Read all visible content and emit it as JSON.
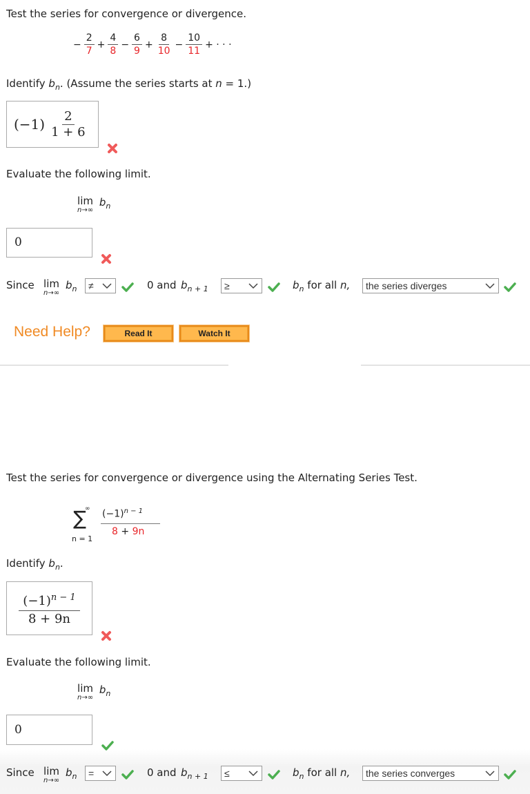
{
  "colors": {
    "accent_red": "#e8262a",
    "help_orange": "#f08a24",
    "button_fill": "#ffb84d",
    "check_green": "#4caf50",
    "x_red": "#f05a5a"
  },
  "problem1": {
    "prompt": "Test the series for convergence or divergence.",
    "series": {
      "terms": [
        {
          "sign": "−",
          "num": "2",
          "den": "7"
        },
        {
          "sign": "+",
          "num": "4",
          "den": "8"
        },
        {
          "sign": "−",
          "num": "6",
          "den": "9"
        },
        {
          "sign": "+",
          "num": "8",
          "den": "10"
        },
        {
          "sign": "−",
          "num": "10",
          "den": "11"
        }
      ],
      "tail": "+ · · ·"
    },
    "identify_label_pre": "Identify ",
    "identify_b": "b",
    "identify_sub": "n",
    "identify_label_post": ". (Assume the series starts at ",
    "identify_n": "n",
    "identify_eq": " = 1.)",
    "bn_answer": {
      "prefix": "(−1)",
      "num": "2",
      "den": "1 + 6"
    },
    "bn_status": "incorrect",
    "evaluate_label": "Evaluate the following limit.",
    "limit": {
      "lim": "lim",
      "sub": "n→∞",
      "b": "b",
      "bsub": "n"
    },
    "limit_answer": "0",
    "limit_status": "incorrect",
    "since": {
      "since_label": "Since",
      "lim": "lim",
      "lim_sub": "n→∞",
      "b": "b",
      "bsub": "n",
      "select1_value": "≠",
      "select1_status": "correct",
      "zero_and": "0 and",
      "b2": "b",
      "b2sub": "n + 1",
      "select2_value": "≥",
      "select2_status": "correct",
      "b3": "b",
      "b3sub": "n",
      "for_all": "for all",
      "n": "n,",
      "select3_value": "the series diverges",
      "select3_status": "correct"
    },
    "help": {
      "label": "Need Help?",
      "read_it": "Read It",
      "watch_it": "Watch It"
    }
  },
  "problem2": {
    "prompt": "Test the series for convergence or divergence using the Alternating Series Test.",
    "series": {
      "sum_upper": "∞",
      "sum_symbol": "∑",
      "sum_lower": "n = 1",
      "numerator_base": "(−1)",
      "numerator_exp": "n − 1",
      "denominator_a": "8",
      "denominator_plus": " + ",
      "denominator_b": "9n"
    },
    "identify_label_pre": "Identify ",
    "identify_b": "b",
    "identify_sub": "n",
    "identify_label_post": ".",
    "bn_answer": {
      "num_base": "(−1)",
      "num_exp": "n − 1",
      "den": "8 + 9n"
    },
    "bn_status": "incorrect",
    "evaluate_label": "Evaluate the following limit.",
    "limit": {
      "lim": "lim",
      "sub": "n→∞",
      "b": "b",
      "bsub": "n"
    },
    "limit_answer": "0",
    "limit_status": "correct",
    "since": {
      "since_label": "Since",
      "lim": "lim",
      "lim_sub": "n→∞",
      "b": "b",
      "bsub": "n",
      "select1_value": "=",
      "select1_status": "correct",
      "zero_and": "0 and",
      "b2": "b",
      "b2sub": "n + 1",
      "select2_value": "≤",
      "select2_status": "correct",
      "b3": "b",
      "b3sub": "n",
      "for_all": "for all",
      "n": "n,",
      "select3_value": "the series converges",
      "select3_status": "correct"
    }
  }
}
